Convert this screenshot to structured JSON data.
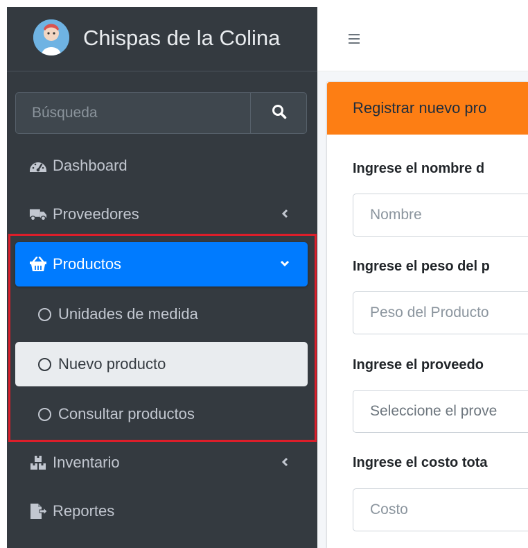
{
  "brand": {
    "title": "Chispas de la Colina"
  },
  "search": {
    "placeholder": "Búsqueda"
  },
  "nav": {
    "dashboard": "Dashboard",
    "proveedores": "Proveedores",
    "productos": "Productos",
    "productos_sub": [
      "Unidades de medida",
      "Nuevo producto",
      "Consultar productos"
    ],
    "inventario": "Inventario",
    "reportes": "Reportes"
  },
  "topbar": {
    "menu_icon": "hamburger-icon"
  },
  "card": {
    "header": "Registrar nuevo pro",
    "fields": [
      {
        "label": "Ingrese el nombre d",
        "placeholder": "Nombre"
      },
      {
        "label": "Ingrese el peso del p",
        "placeholder": "Peso del Producto"
      },
      {
        "label": "Ingrese el proveedo",
        "placeholder": "Seleccione el prove"
      },
      {
        "label": "Ingrese el costo tota",
        "placeholder": "Costo"
      }
    ]
  },
  "colors": {
    "sidebar_bg": "#343a40",
    "active_nav": "#007bff",
    "card_header": "#fd7e14",
    "highlight": "#dc1e2a"
  }
}
